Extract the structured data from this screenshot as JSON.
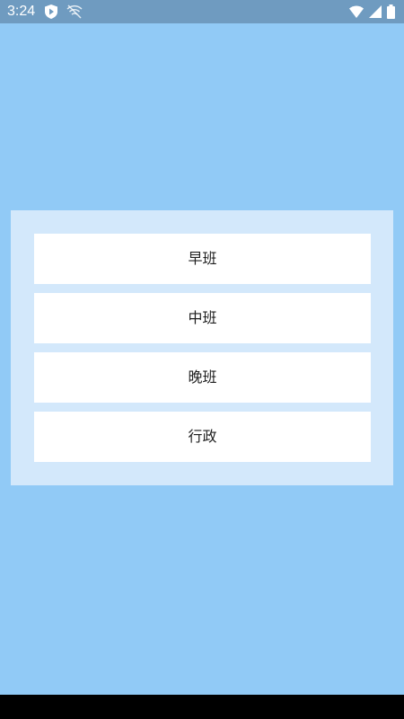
{
  "status_bar": {
    "time": "3:24",
    "icons": [
      "play-protect-icon",
      "wifi-off-icon",
      "wifi-icon",
      "signal-icon",
      "battery-icon"
    ]
  },
  "shift_options": [
    {
      "label": "早班"
    },
    {
      "label": "中班"
    },
    {
      "label": "晚班"
    },
    {
      "label": "行政"
    }
  ],
  "colors": {
    "background": "#91caf6",
    "status_bar": "#6f9bc0",
    "panel": "#d3e8fb",
    "button": "#ffffff",
    "nav_bar": "#000000"
  }
}
